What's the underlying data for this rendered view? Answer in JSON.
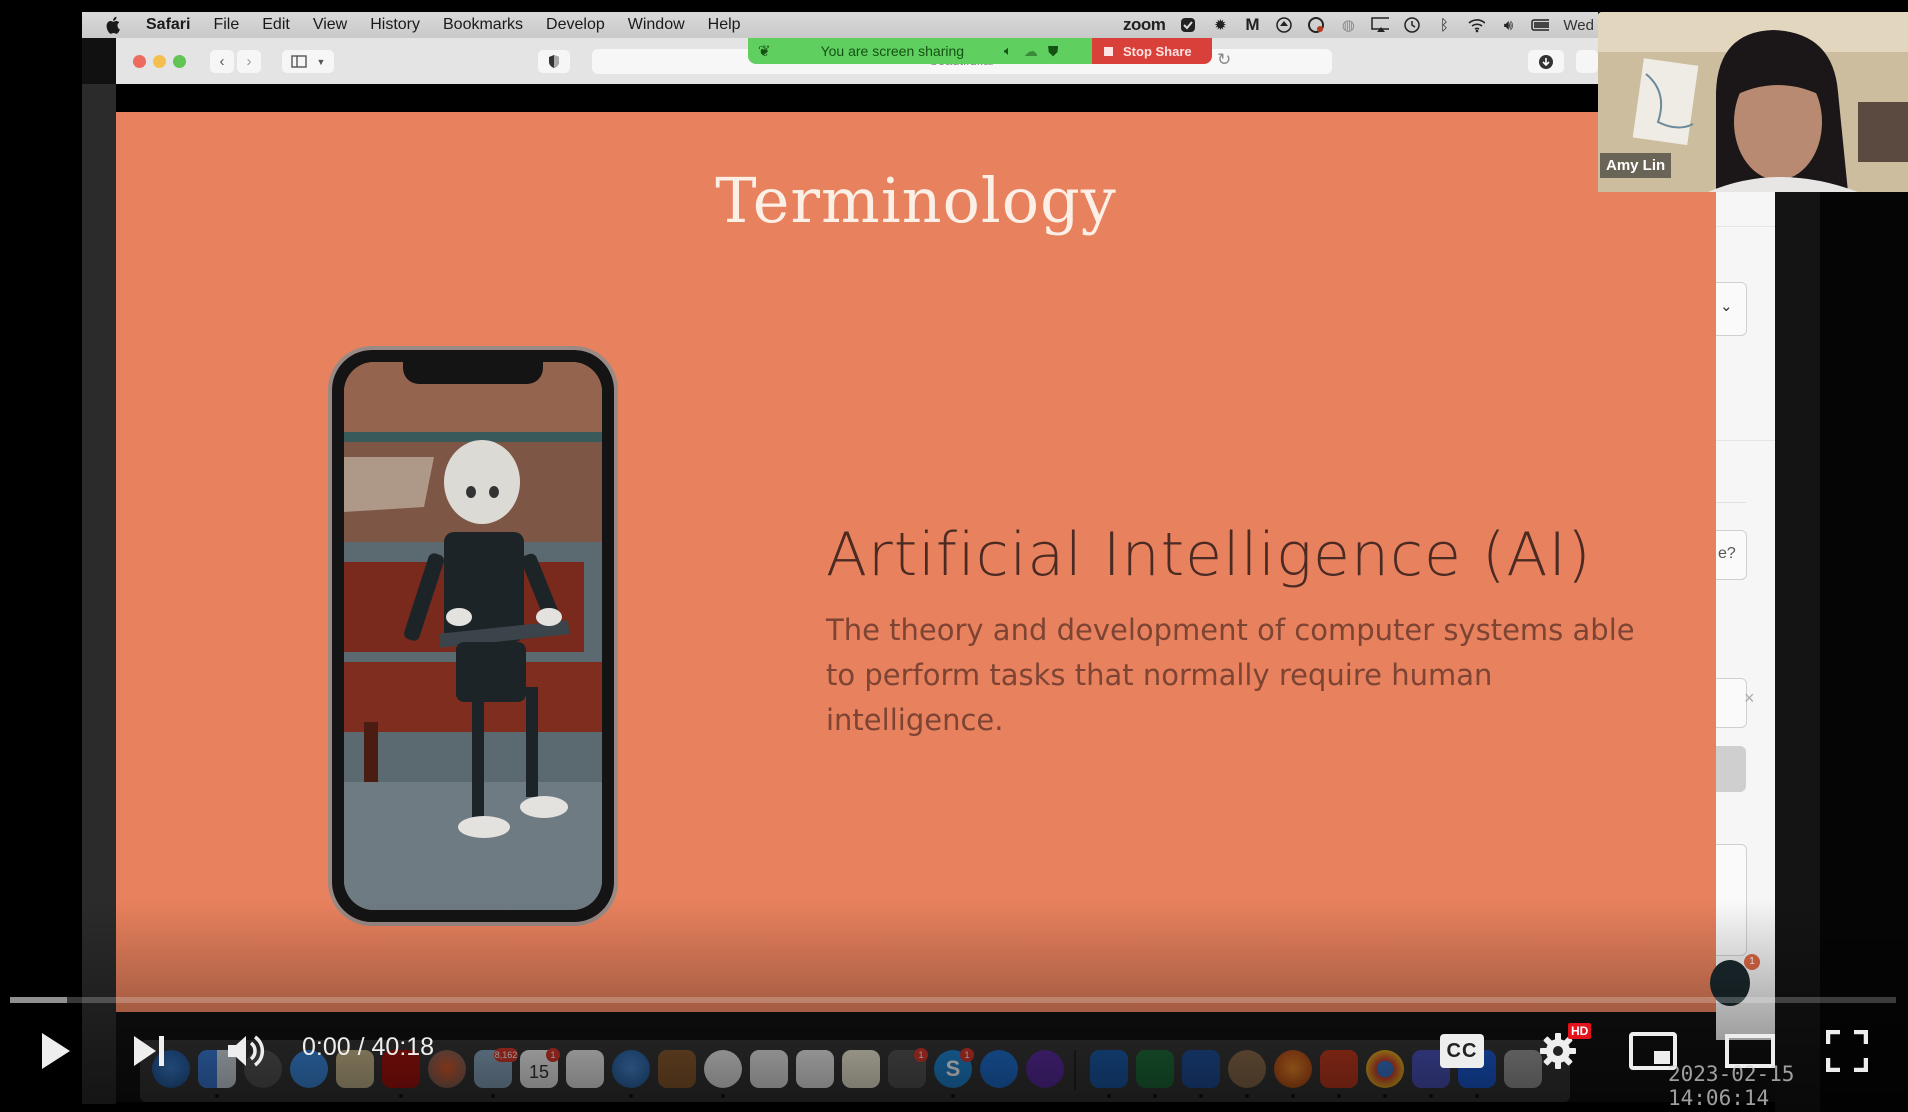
{
  "menubar": {
    "items": [
      "Safari",
      "File",
      "Edit",
      "View",
      "History",
      "Bookmarks",
      "Develop",
      "Window",
      "Help"
    ],
    "status_app": "zoom",
    "clock_partial": "Wed"
  },
  "browser": {
    "url": "beautiful.ai"
  },
  "share_banner": {
    "label": "You are screen sharing",
    "stop_label": "Stop Share",
    "banner_color": "#5fcf5f",
    "stop_color": "#d9403a"
  },
  "slide": {
    "title": "Terminology",
    "term": "Artificial Intelligence (AI)",
    "definition": "The theory and development of computer systems able to perform tasks that normally require human intelligence.",
    "background_color": "#e8815d",
    "image_alt": "robot sitting on a bench with a laptop, shown on a phone"
  },
  "webcam": {
    "participant_name": "Amy Lin"
  },
  "dock": {
    "badges": {
      "mail": "8,162",
      "calendar": "1",
      "settings": "1",
      "skype": "1"
    },
    "calendar_day": "15"
  },
  "player": {
    "current_time": "0:00",
    "duration": "40:18",
    "time_display": "0:00 / 40:18",
    "played_fraction": 0.0,
    "buffered_fraction": 0.03,
    "quality_badge": "HD",
    "cc_label": "CC",
    "recording_timestamp": "2023-02-15 14:06:14",
    "buttons": [
      "play",
      "next",
      "volume",
      "captions",
      "settings",
      "miniplayer",
      "theater",
      "fullscreen"
    ]
  },
  "page_fragment": {
    "visible_text": "e?",
    "notification_count": "1"
  }
}
